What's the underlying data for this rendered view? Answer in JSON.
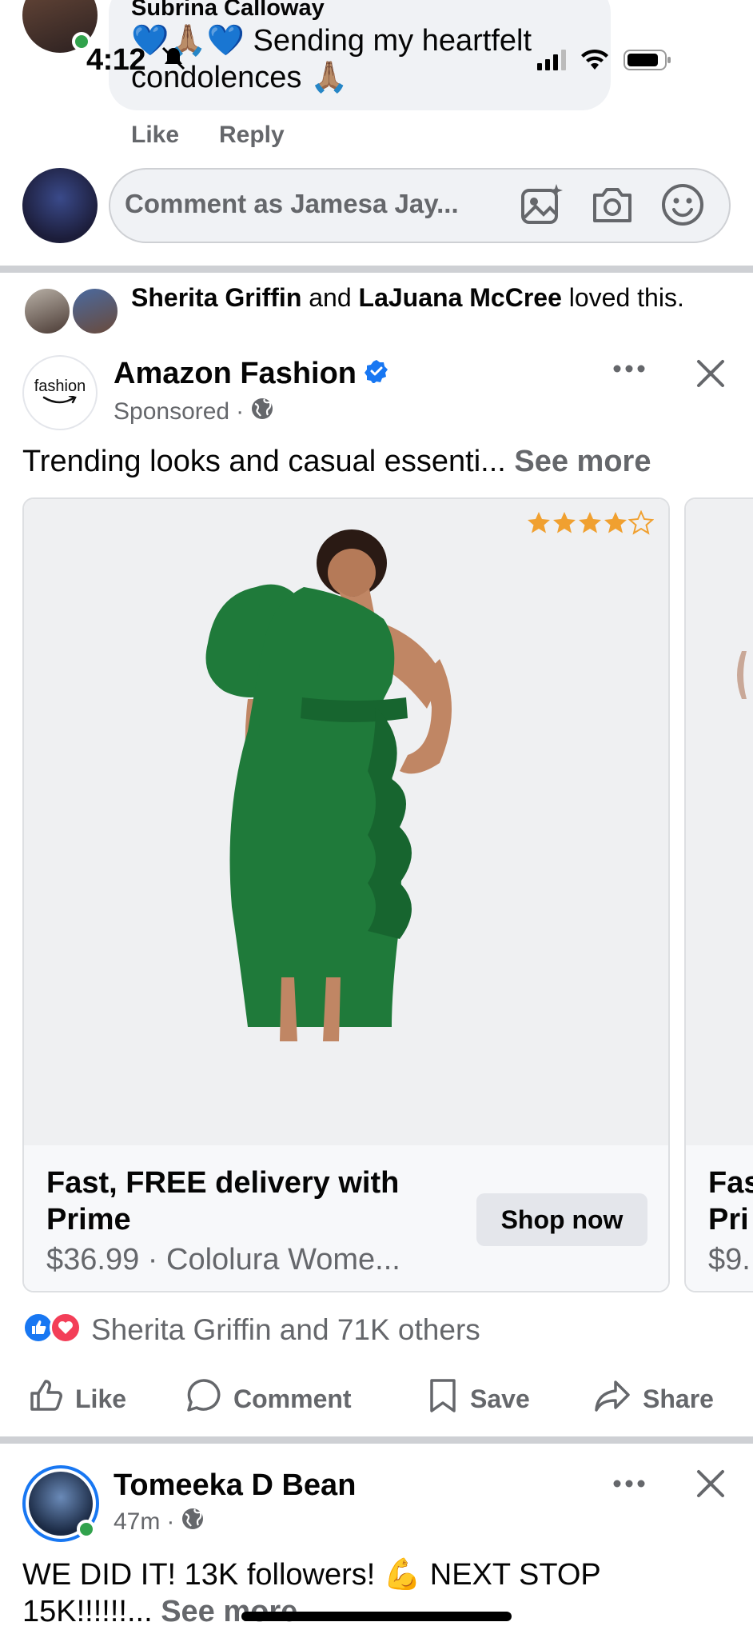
{
  "status_bar": {
    "time": "4:12",
    "icons": [
      "silent-mode-icon",
      "signal-icon",
      "wifi-icon",
      "battery-icon"
    ]
  },
  "top_comment": {
    "author": "Subrina Calloway",
    "text_emoji_prefix": "💙🙏🏽💙",
    "text": "Sending my heartfelt condolences",
    "text_emoji_suffix": "🙏🏽",
    "actions": {
      "like": "Like",
      "reply": "Reply"
    }
  },
  "comment_box": {
    "placeholder": "Comment as Jamesa Jay...",
    "icons": [
      "image-sparkle-icon",
      "camera-icon",
      "emoji-icon"
    ]
  },
  "ad_post": {
    "loved_by": {
      "name1": "Sherita Griffin",
      "joiner": "and",
      "name2": "LaJuana McCree",
      "suffix": "loved this."
    },
    "page_logo_text": "fashion",
    "page_name": "Amazon Fashion",
    "verified": true,
    "sponsored_label": "Sponsored",
    "dot": "·",
    "text": "Trending looks and casual essenti...",
    "see_more": "See more",
    "rating_stars": 4.5,
    "card": {
      "title": "Fast, FREE delivery with Prime",
      "price_line": "$36.99 · Cololura Wome...",
      "cta": "Shop now"
    },
    "card2": {
      "title_partial": "Fas",
      "title_partial2": "Pri",
      "price_partial": "$9."
    },
    "reactions_text": "Sherita Griffin and 71K others",
    "actions": {
      "like": "Like",
      "comment": "Comment",
      "save": "Save",
      "share": "Share"
    }
  },
  "next_post": {
    "author": "Tomeeka D Bean",
    "time": "47m",
    "dot": "·",
    "text": "WE DID IT! 13K followers! 💪 NEXT STOP 15K!!!!!!...",
    "see_more": "See more"
  },
  "colors": {
    "accent_blue": "#1877f2",
    "secondary_text": "#65676b",
    "dress_green": "#1f7a3a",
    "star_orange": "#f0a030",
    "love_red": "#f33e58",
    "online_green": "#31a24c"
  }
}
